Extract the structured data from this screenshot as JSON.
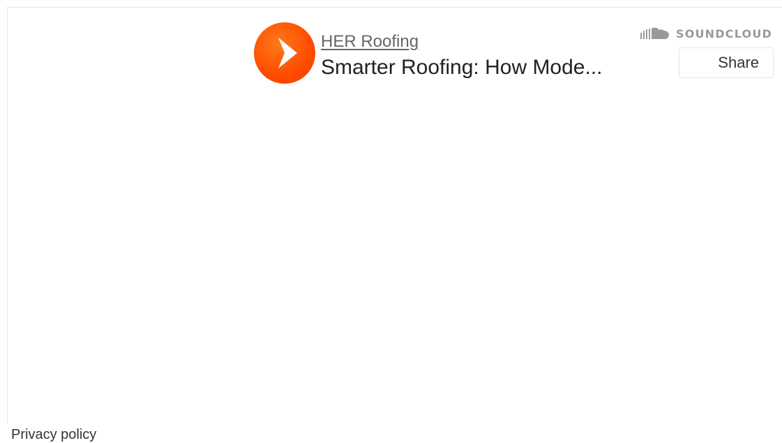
{
  "player": {
    "artist": "HER Roofing",
    "track_title": "Smarter Roofing: How Mode...",
    "brand_label": "SOUNDCLOUD",
    "share_label": "Share",
    "play_icon": "play-icon",
    "brand_icon": "soundcloud-logo-icon"
  },
  "footer": {
    "privacy_label": "Privacy policy"
  },
  "colors": {
    "accent": "#ff5500",
    "muted_text": "#999999",
    "border": "#e5e5e5"
  }
}
